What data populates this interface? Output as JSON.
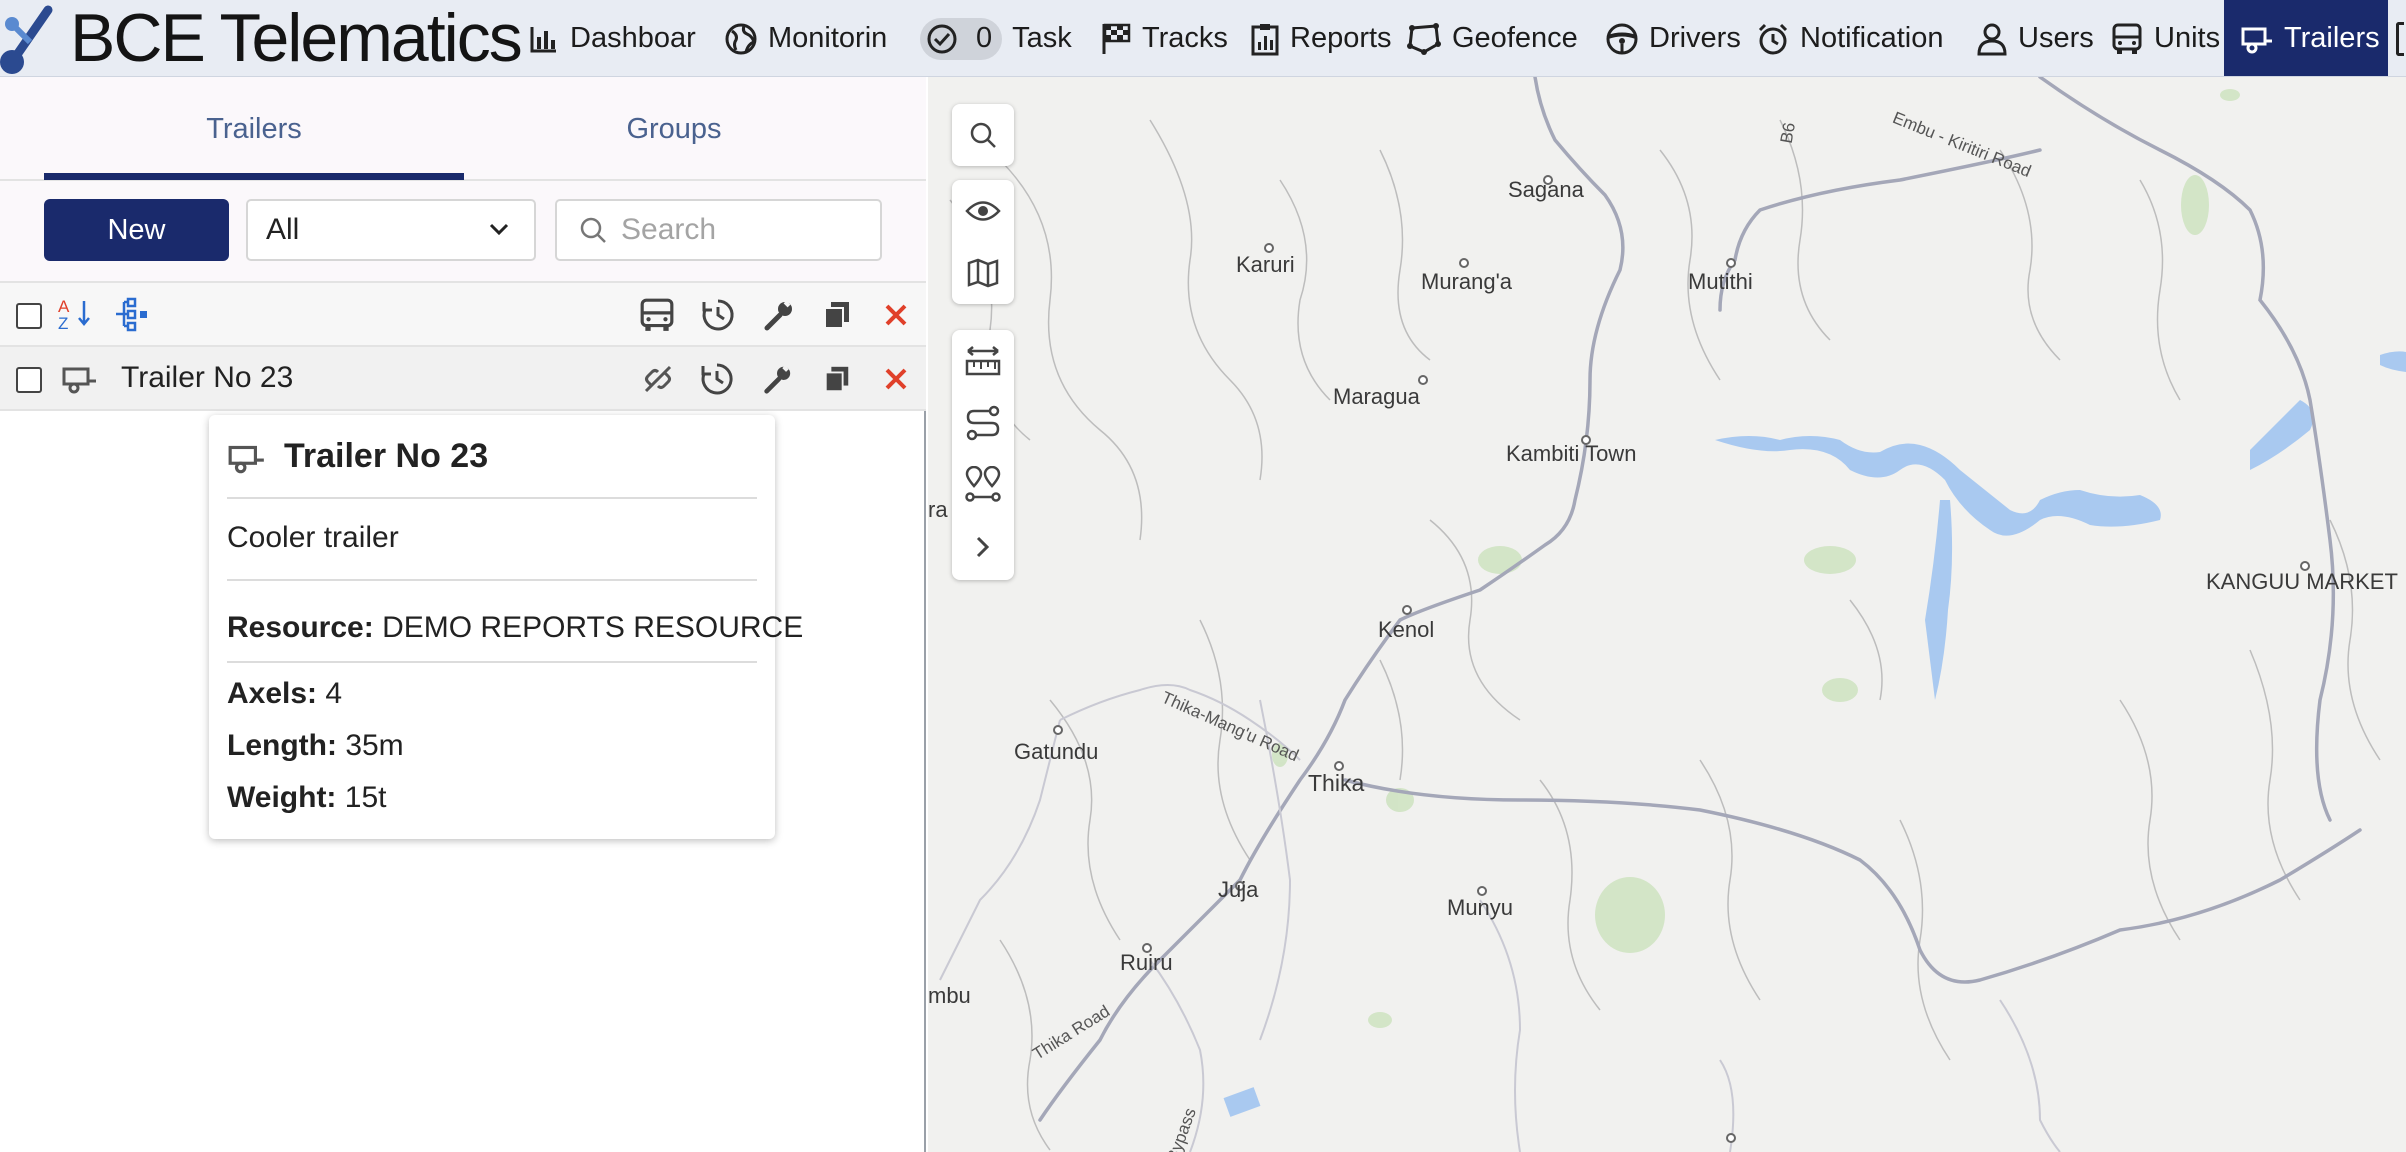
{
  "app": {
    "logo_text": "BCE Telematics"
  },
  "nav": {
    "dashboard": "Dashboar",
    "monitoring": "Monitorin",
    "tasks_count": "0",
    "tasks": "Task",
    "tracks": "Tracks",
    "reports": "Reports",
    "geofence": "Geofence",
    "drivers": "Drivers",
    "notifications": "Notification",
    "users": "Users",
    "units": "Units",
    "trailers": "Trailers"
  },
  "panel": {
    "tabs": [
      "Trailers",
      "Groups"
    ],
    "active_tab": "Trailers",
    "new_button": "New",
    "filter_value": "All",
    "search_placeholder": "Search",
    "items": [
      {
        "name": "Trailer No 23"
      }
    ]
  },
  "popup": {
    "title": "Trailer No 23",
    "description": "Cooler trailer",
    "resource_label": "Resource:",
    "resource_value": "DEMO REPORTS RESOURCE",
    "axels_label": "Axels:",
    "axels_value": "4",
    "length_label": "Length:",
    "length_value": "35m",
    "weight_label": "Weight:",
    "weight_value": "15t"
  },
  "map": {
    "places": [
      "Sagana",
      "Karuri",
      "Murang'a",
      "Mutithi",
      "Maragua",
      "Kambiti Town",
      "Kenol",
      "KANGUU MARKET",
      "Gatundu",
      "Thika",
      "Juja",
      "Munyu",
      "Ruiru",
      "mbu",
      "ra"
    ],
    "roads": [
      "B6",
      "Embu - Kiritiri Road",
      "Thika-Mang'u Road",
      "Thika Road",
      "Bypass"
    ]
  },
  "colors": {
    "brand": "#1a2a6c",
    "topbar_bg": "#e8ecf3",
    "delete_red": "#e0402a",
    "water": "#a9c9f0"
  }
}
